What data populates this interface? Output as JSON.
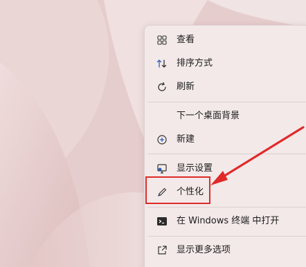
{
  "menu": {
    "items": [
      {
        "label": "查看",
        "icon": "grid-icon"
      },
      {
        "label": "排序方式",
        "icon": "sort-icon"
      },
      {
        "label": "刷新",
        "icon": "refresh-icon"
      },
      {
        "label": "下一个桌面背景",
        "icon": ""
      },
      {
        "label": "新建",
        "icon": "plus-circle-icon"
      },
      {
        "label": "显示设置",
        "icon": "display-icon"
      },
      {
        "label": "个性化",
        "icon": "pen-icon"
      },
      {
        "label": "在 Windows 终端 中打开",
        "icon": "terminal-icon"
      },
      {
        "label": "显示更多选项",
        "icon": "share-icon"
      }
    ]
  },
  "annotation": {
    "highlight_color": "#e02a2a",
    "highlighted_item": "个性化"
  },
  "colors": {
    "wallpaper": "#e7d0d0",
    "menu_background": "#f3e9e9"
  }
}
